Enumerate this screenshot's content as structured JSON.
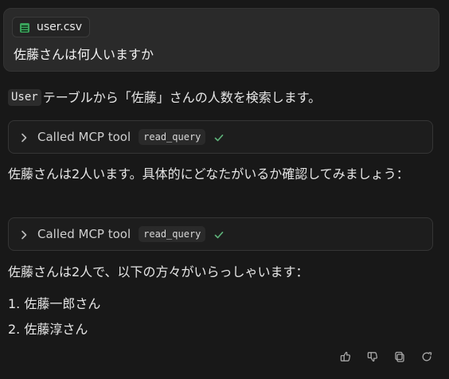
{
  "user_message": {
    "attachment_name": "user.csv",
    "text": "佐藤さんは何人いますか"
  },
  "assistant": {
    "intro": {
      "code": "User",
      "text": "テーブルから「佐藤」さんの人数を検索します。"
    },
    "tool_calls": [
      {
        "label": "Called MCP tool",
        "tool": "read_query"
      },
      {
        "label": "Called MCP tool",
        "tool": "read_query"
      }
    ],
    "paragraph_1": "佐藤さんは2人います。具体的にどなたがいるか確認してみましょう：",
    "paragraph_2": "佐藤さんは2人で、以下の方々がいらっしゃいます：",
    "names": [
      "1. 佐藤一郎さん",
      "2. 佐藤淳さん"
    ]
  },
  "actions": {
    "icons": [
      "thumbs-up-icon",
      "thumbs-down-icon",
      "copy-icon",
      "refresh-icon"
    ]
  },
  "colors": {
    "background": "#181818",
    "card": "#2a2a2a",
    "tool_border": "#353535",
    "accent_green": "#3aa35b",
    "check_green": "#64c283"
  }
}
